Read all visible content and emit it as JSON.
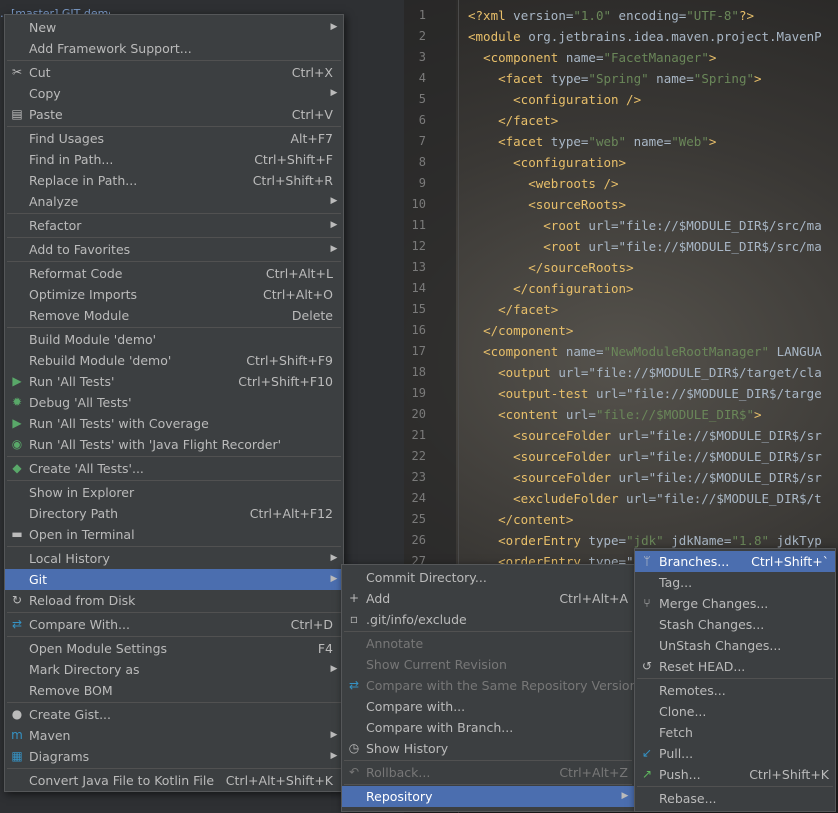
{
  "project": {
    "title": "…[master] GIT demo"
  },
  "editor": {
    "line_numbers": [
      "1",
      "2",
      "3",
      "4",
      "5",
      "6",
      "7",
      "8",
      "9",
      "10",
      "11",
      "12",
      "13",
      "14",
      "15",
      "16",
      "17",
      "18",
      "19",
      "20",
      "21",
      "22",
      "23",
      "24",
      "25",
      "26",
      "27"
    ],
    "lines": [
      "<?xml version=\"1.0\" encoding=\"UTF-8\"?>",
      "<module org.jetbrains.idea.maven.project.MavenP",
      "  <component name=\"FacetManager\">",
      "    <facet type=\"Spring\" name=\"Spring\">",
      "      <configuration />",
      "    </facet>",
      "    <facet type=\"web\" name=\"Web\">",
      "      <configuration>",
      "        <webroots />",
      "        <sourceRoots>",
      "          <root url=\"file://$MODULE_DIR$/src/ma",
      "          <root url=\"file://$MODULE_DIR$/src/ma",
      "        </sourceRoots>",
      "      </configuration>",
      "    </facet>",
      "  </component>",
      "  <component name=\"NewModuleRootManager\" LANGUA",
      "    <output url=\"file://$MODULE_DIR$/target/cla",
      "    <output-test url=\"file://$MODULE_DIR$/targe",
      "    <content url=\"file://$MODULE_DIR$\">",
      "      <sourceFolder url=\"file://$MODULE_DIR$/sr",
      "      <sourceFolder url=\"file://$MODULE_DIR$/sr",
      "      <sourceFolder url=\"file://$MODULE_DIR$/sr",
      "      <excludeFolder url=\"file://$MODULE_DIR$/t",
      "    </content>",
      "    <orderEntry type=\"jdk\" jdkName=\"1.8\" jdkTyp",
      "    <orderEntry type=\""
    ]
  },
  "context_menu": {
    "items": [
      {
        "label": "New",
        "shortcut": "",
        "submenu": true,
        "icon": ""
      },
      {
        "label": "Add Framework Support...",
        "shortcut": "",
        "submenu": false,
        "icon": ""
      },
      {
        "label": "Cut",
        "shortcut": "Ctrl+X",
        "submenu": false,
        "icon": "scissors"
      },
      {
        "label": "Copy",
        "shortcut": "",
        "submenu": true,
        "icon": ""
      },
      {
        "label": "Paste",
        "shortcut": "Ctrl+V",
        "submenu": false,
        "icon": "clipboard"
      },
      {
        "label": "Find Usages",
        "shortcut": "Alt+F7",
        "submenu": false,
        "icon": ""
      },
      {
        "label": "Find in Path...",
        "shortcut": "Ctrl+Shift+F",
        "submenu": false,
        "icon": ""
      },
      {
        "label": "Replace in Path...",
        "shortcut": "Ctrl+Shift+R",
        "submenu": false,
        "icon": ""
      },
      {
        "label": "Analyze",
        "shortcut": "",
        "submenu": true,
        "icon": ""
      },
      {
        "label": "Refactor",
        "shortcut": "",
        "submenu": true,
        "icon": ""
      },
      {
        "label": "Add to Favorites",
        "shortcut": "",
        "submenu": true,
        "icon": ""
      },
      {
        "label": "Reformat Code",
        "shortcut": "Ctrl+Alt+L",
        "submenu": false,
        "icon": ""
      },
      {
        "label": "Optimize Imports",
        "shortcut": "Ctrl+Alt+O",
        "submenu": false,
        "icon": ""
      },
      {
        "label": "Remove Module",
        "shortcut": "Delete",
        "submenu": false,
        "icon": ""
      },
      {
        "label": "Build Module 'demo'",
        "shortcut": "",
        "submenu": false,
        "icon": ""
      },
      {
        "label": "Rebuild Module 'demo'",
        "shortcut": "Ctrl+Shift+F9",
        "submenu": false,
        "icon": ""
      },
      {
        "label": "Run 'All Tests'",
        "shortcut": "Ctrl+Shift+F10",
        "submenu": false,
        "icon": "run"
      },
      {
        "label": "Debug 'All Tests'",
        "shortcut": "",
        "submenu": false,
        "icon": "debug"
      },
      {
        "label": "Run 'All Tests' with Coverage",
        "shortcut": "",
        "submenu": false,
        "icon": "coverage"
      },
      {
        "label": "Run 'All Tests' with 'Java Flight Recorder'",
        "shortcut": "",
        "submenu": false,
        "icon": "profiler"
      },
      {
        "label": "Create 'All Tests'...",
        "shortcut": "",
        "submenu": false,
        "icon": "create"
      },
      {
        "label": "Show in Explorer",
        "shortcut": "",
        "submenu": false,
        "icon": ""
      },
      {
        "label": "Directory Path",
        "shortcut": "Ctrl+Alt+F12",
        "submenu": false,
        "icon": ""
      },
      {
        "label": "Open in Terminal",
        "shortcut": "",
        "submenu": false,
        "icon": "terminal"
      },
      {
        "label": "Local History",
        "shortcut": "",
        "submenu": true,
        "icon": ""
      },
      {
        "label": "Git",
        "shortcut": "",
        "submenu": true,
        "icon": ""
      },
      {
        "label": "Reload from Disk",
        "shortcut": "",
        "submenu": false,
        "icon": "reload"
      },
      {
        "label": "Compare With...",
        "shortcut": "Ctrl+D",
        "submenu": false,
        "icon": "compare"
      },
      {
        "label": "Open Module Settings",
        "shortcut": "F4",
        "submenu": false,
        "icon": ""
      },
      {
        "label": "Mark Directory as",
        "shortcut": "",
        "submenu": true,
        "icon": ""
      },
      {
        "label": "Remove BOM",
        "shortcut": "",
        "submenu": false,
        "icon": ""
      },
      {
        "label": "Create Gist...",
        "shortcut": "",
        "submenu": false,
        "icon": "github"
      },
      {
        "label": "Maven",
        "shortcut": "",
        "submenu": true,
        "icon": "maven"
      },
      {
        "label": "Diagrams",
        "shortcut": "",
        "submenu": true,
        "icon": "diagram"
      },
      {
        "label": "Convert Java File to Kotlin File",
        "shortcut": "Ctrl+Alt+Shift+K",
        "submenu": false,
        "icon": ""
      }
    ]
  },
  "git_menu": {
    "items": [
      {
        "label": "Commit Directory...",
        "shortcut": "",
        "submenu": false,
        "disabled": false,
        "icon": ""
      },
      {
        "label": "Add",
        "shortcut": "Ctrl+Alt+A",
        "submenu": false,
        "disabled": false,
        "icon": "plus"
      },
      {
        "label": ".git/info/exclude",
        "shortcut": "",
        "submenu": false,
        "disabled": false,
        "icon": "file"
      },
      {
        "label": "Annotate",
        "shortcut": "",
        "submenu": false,
        "disabled": true,
        "icon": ""
      },
      {
        "label": "Show Current Revision",
        "shortcut": "",
        "submenu": false,
        "disabled": true,
        "icon": ""
      },
      {
        "label": "Compare with the Same Repository Version",
        "shortcut": "",
        "submenu": false,
        "disabled": true,
        "icon": "compare"
      },
      {
        "label": "Compare with...",
        "shortcut": "",
        "submenu": false,
        "disabled": false,
        "icon": ""
      },
      {
        "label": "Compare with Branch...",
        "shortcut": "",
        "submenu": false,
        "disabled": false,
        "icon": ""
      },
      {
        "label": "Show History",
        "shortcut": "",
        "submenu": false,
        "disabled": false,
        "icon": "clock"
      },
      {
        "label": "Rollback...",
        "shortcut": "Ctrl+Alt+Z",
        "submenu": false,
        "disabled": true,
        "icon": "rollback"
      },
      {
        "label": "Repository",
        "shortcut": "",
        "submenu": true,
        "disabled": false,
        "icon": ""
      }
    ]
  },
  "repository_menu": {
    "items": [
      {
        "label": "Branches...",
        "shortcut": "Ctrl+Shift+`",
        "icon": "branch"
      },
      {
        "label": "Tag...",
        "shortcut": "",
        "icon": ""
      },
      {
        "label": "Merge Changes...",
        "shortcut": "",
        "icon": "merge"
      },
      {
        "label": "Stash Changes...",
        "shortcut": "",
        "icon": ""
      },
      {
        "label": "UnStash Changes...",
        "shortcut": "",
        "icon": ""
      },
      {
        "label": "Reset HEAD...",
        "shortcut": "",
        "icon": "reset"
      },
      {
        "label": "Remotes...",
        "shortcut": "",
        "icon": ""
      },
      {
        "label": "Clone...",
        "shortcut": "",
        "icon": ""
      },
      {
        "label": "Fetch",
        "shortcut": "",
        "icon": ""
      },
      {
        "label": "Pull...",
        "shortcut": "",
        "icon": "pull"
      },
      {
        "label": "Push...",
        "shortcut": "Ctrl+Shift+K",
        "icon": "push"
      },
      {
        "label": "Rebase...",
        "shortcut": "",
        "icon": ""
      }
    ]
  }
}
